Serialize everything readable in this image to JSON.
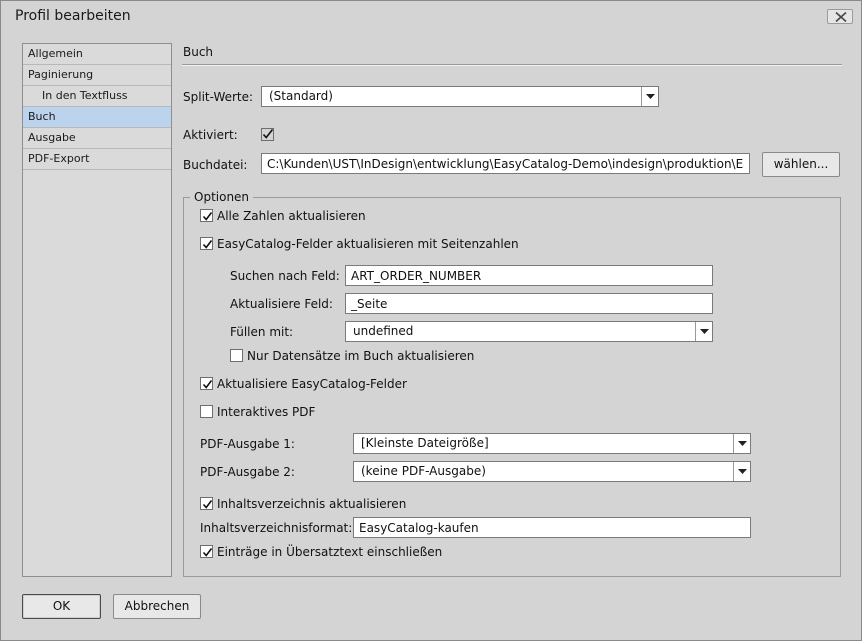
{
  "window": {
    "title": "Profil bearbeiten"
  },
  "sidebar": {
    "items": [
      {
        "label": "Allgemein",
        "selected": false
      },
      {
        "label": "Paginierung",
        "selected": false
      },
      {
        "label": "In den Textfluss",
        "selected": false
      },
      {
        "label": "Buch",
        "selected": true
      },
      {
        "label": "Ausgabe",
        "selected": false
      },
      {
        "label": "PDF-Export",
        "selected": false
      }
    ]
  },
  "main": {
    "section_title": "Buch",
    "split": {
      "label": "Split-Werte:",
      "value": "(Standard)"
    },
    "activated": {
      "label": "Aktiviert:",
      "checked": true
    },
    "bookfile": {
      "label": "Buchdatei:",
      "value": "C:\\Kunden\\UST\\InDesign\\entwicklung\\EasyCatalog-Demo\\indesign\\produktion\\EasyCata",
      "choose_button": "wählen..."
    },
    "options": {
      "legend": "Optionen",
      "update_all_numbers": {
        "label": "Alle Zahlen aktualisieren",
        "checked": true
      },
      "update_fields_pages": {
        "label": "EasyCatalog-Felder aktualisieren mit Seitenzahlen",
        "checked": true
      },
      "search_field": {
        "label": "Suchen nach Feld:",
        "value": "ART_ORDER_NUMBER"
      },
      "update_field": {
        "label": "Aktualisiere Feld:",
        "value": "_Seite"
      },
      "fill_with": {
        "label": "Füllen mit:",
        "value": "undefined"
      },
      "only_book_records": {
        "label": "Nur Datensätze im Buch aktualisieren",
        "checked": false
      },
      "update_ec_fields": {
        "label": "Aktualisiere EasyCatalog-Felder",
        "checked": true
      },
      "interactive_pdf": {
        "label": "Interaktives PDF",
        "checked": false
      },
      "pdf_output_1": {
        "label": "PDF-Ausgabe 1:",
        "value": "[Kleinste Dateigröße]"
      },
      "pdf_output_2": {
        "label": "PDF-Ausgabe 2:",
        "value": "(keine PDF-Ausgabe)"
      },
      "update_toc": {
        "label": "Inhaltsverzeichnis aktualisieren",
        "checked": true
      },
      "toc_format": {
        "label": "Inhaltsverzeichnisformat:",
        "value": "EasyCatalog-kaufen"
      },
      "include_overset": {
        "label": "Einträge in Übersatztext einschließen",
        "checked": true
      }
    }
  },
  "footer": {
    "ok": "OK",
    "cancel": "Abbrechen"
  },
  "icons": {
    "close": "close-icon",
    "dropdown": "chevron-down-icon",
    "check": "check-icon"
  }
}
